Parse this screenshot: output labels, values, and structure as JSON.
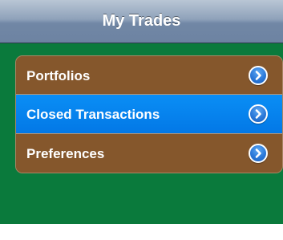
{
  "navbar": {
    "title": "My Trades"
  },
  "menu": {
    "items": [
      {
        "label": "Portfolios",
        "selected": false,
        "icon": "chevron-right-circle-icon"
      },
      {
        "label": "Closed Transactions",
        "selected": true,
        "icon": "chevron-right-circle-icon"
      },
      {
        "label": "Preferences",
        "selected": false,
        "icon": "chevron-right-circle-icon"
      }
    ]
  },
  "colors": {
    "background": "#0a7a3c",
    "row": "#85572c",
    "row_selected": "#0378e6",
    "navbar": "#7187a5"
  }
}
